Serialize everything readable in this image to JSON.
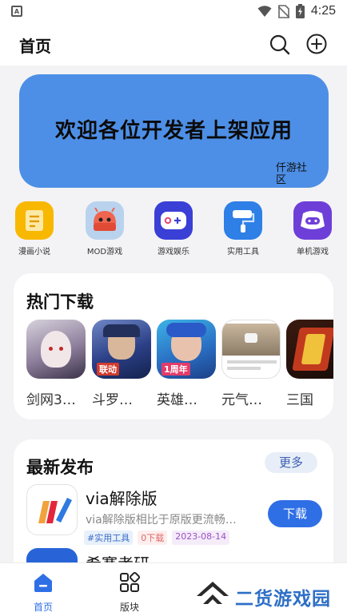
{
  "status_bar": {
    "time": "4:25",
    "app_badge": "A"
  },
  "header": {
    "title": "首页"
  },
  "banner": {
    "text": "欢迎各位开发者上架应用",
    "signature": "仟游社区"
  },
  "categories": [
    {
      "label": "漫画小说",
      "icon": "book-icon",
      "color": "#f8b800"
    },
    {
      "label": "MOD游戏",
      "icon": "game-mascot-icon",
      "color": "#f0654f"
    },
    {
      "label": "游戏娱乐",
      "icon": "gamepad-icon",
      "color": "#3a3fd6"
    },
    {
      "label": "实用工具",
      "icon": "paint-roller-icon",
      "color": "#2e7fe6"
    },
    {
      "label": "单机游戏",
      "icon": "controller-icon",
      "color": "#6e3fd8"
    }
  ],
  "hot": {
    "title": "热门下载",
    "apps": [
      {
        "name": "剑网3…",
        "overlay": ""
      },
      {
        "name": "斗罗…",
        "overlay": "联动"
      },
      {
        "name": "英雄…",
        "overlay": "1周年"
      },
      {
        "name": "元气…",
        "overlay": ""
      },
      {
        "name": "三国",
        "overlay": ""
      }
    ]
  },
  "latest": {
    "title": "最新发布",
    "more_label": "更多",
    "items": [
      {
        "name": "via解除版",
        "desc": "via解除版相比于原版更流畅…",
        "tag_category": "#实用工具",
        "tag_downloads": "0下载",
        "tag_date": "2023-08-14",
        "button": "下载"
      },
      {
        "name": "希赛考研"
      }
    ]
  },
  "tabbar": {
    "items": [
      {
        "label": "首页",
        "active": true
      },
      {
        "label": "版块",
        "active": false
      }
    ]
  },
  "watermark": {
    "text": "二货游戏园"
  },
  "colors": {
    "accent": "#2f6fe6",
    "banner": "#4d8fe6",
    "background": "#f3f3f5"
  }
}
